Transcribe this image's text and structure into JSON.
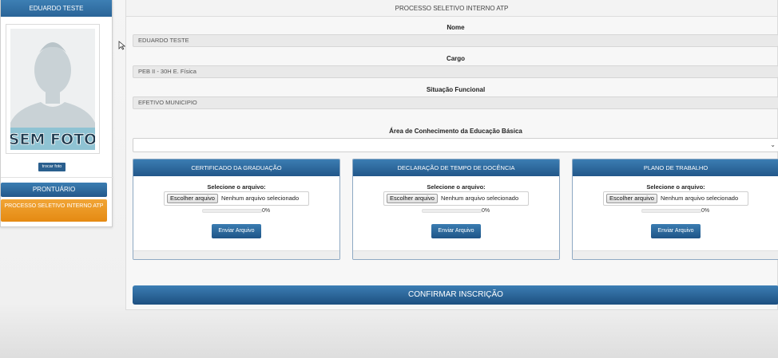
{
  "sidebar": {
    "user_name": "EDUARDO TESTE",
    "photo_placeholder": "SEM FOTO",
    "change_photo_label": "trocar foto",
    "menu": [
      {
        "label": "PRONTUÁRIO"
      },
      {
        "label": "PROCESSO SELETIVO INTERNO ATP"
      }
    ]
  },
  "main": {
    "title": "PROCESSO SELETIVO INTERNO ATP",
    "fields": [
      {
        "label": "Nome",
        "value": "EDUARDO TESTE"
      },
      {
        "label": "Cargo",
        "value": "PEB II - 30H E. Física"
      },
      {
        "label": "Situação Funcional",
        "value": "EFETIVO MUNICIPIO"
      }
    ],
    "area_label": "Área de Conhecimento da Educação Básica",
    "area_value": "",
    "uploads": [
      {
        "title": "CERTIFICADO DA GRADUAÇÃO",
        "select_label": "Selecione o arquivo:",
        "choose_label": "Escolher arquivo",
        "file_status": "Nenhum arquivo selecionado",
        "progress": "0%",
        "send_label": "Enviar Arquivo"
      },
      {
        "title": "DECLARAÇÃO DE TEMPO DE DOCÊNCIA",
        "select_label": "Selecione o arquivo:",
        "choose_label": "Escolher arquivo",
        "file_status": "Nenhum arquivo selecionado",
        "progress": "0%",
        "send_label": "Enviar Arquivo"
      },
      {
        "title": "PLANO DE TRABALHO",
        "select_label": "Selecione o arquivo:",
        "choose_label": "Escolher arquivo",
        "file_status": "Nenhum arquivo selecionado",
        "progress": "0%",
        "send_label": "Enviar Arquivo"
      }
    ],
    "confirm_label": "CONFIRMAR INSCRIÇÃO"
  },
  "colors": {
    "primary_blue": "#2a6497",
    "accent_orange": "#e8951f",
    "placeholder_teal": "#8fc3d3"
  }
}
